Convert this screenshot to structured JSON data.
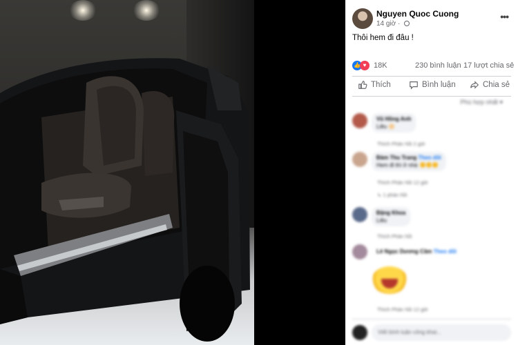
{
  "post": {
    "author": "Nguyen Quoc Cuong",
    "time": "14 giờ · ",
    "text": "Thôi hem đi đâu !"
  },
  "stats": {
    "reactions": "18K",
    "comments": "230 bình luận",
    "shares": "17 lượt chia sẻ"
  },
  "actions": {
    "like": "Thích",
    "comment": "Bình luận",
    "share": "Chia sẻ"
  },
  "comments_section": {
    "sort_label": "Phù hợp nhất ▾",
    "comments": [
      {
        "name": "Vũ Hồng Anh",
        "text": "Liêu 🔆",
        "meta": "Thích   Phản hồi   2 giờ"
      },
      {
        "name": "Đàm Thu Trang",
        "text": "Hem đi thì ở nhà",
        "meta": "Thích   Phản hồi   12 giờ"
      },
      {
        "name": "Đặng Khoa",
        "text": "Liêu",
        "meta": "Thích   Phản hồi"
      },
      {
        "name": "Lê Ngọc Dương Cầm",
        "text": "",
        "meta": "Thích   Phản hồi   12 giờ"
      }
    ],
    "reply_line": "↳ 1 phản hồi",
    "follow_label": "Theo dõi",
    "write_placeholder": "Viết bình luận công khai..."
  },
  "colors": {
    "like": "#1877f2",
    "love": "#f33e58",
    "muted_text": "#65676b"
  }
}
